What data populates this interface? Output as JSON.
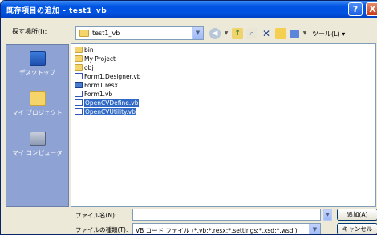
{
  "window": {
    "title": "既存項目の追加 - test1_vb",
    "help_label": "?",
    "close_label": "X"
  },
  "look_in": {
    "label": "探す場所(I):",
    "value": "test1_vb"
  },
  "toolbar": {
    "tools_label": "ツール(L)"
  },
  "places": [
    {
      "label": "デスクトップ",
      "icon": "desktop-icon"
    },
    {
      "label": "マイ プロジェクト",
      "icon": "my-projects-icon"
    },
    {
      "label": "マイ コンピュータ",
      "icon": "my-computer-icon"
    }
  ],
  "files": [
    {
      "name": "bin",
      "type": "folder",
      "selected": false
    },
    {
      "name": "My Project",
      "type": "folder",
      "selected": false
    },
    {
      "name": "obj",
      "type": "folder",
      "selected": false
    },
    {
      "name": "Form1.Designer.vb",
      "type": "vb",
      "selected": false
    },
    {
      "name": "Form1.resx",
      "type": "resx",
      "selected": false
    },
    {
      "name": "Form1.vb",
      "type": "vb",
      "selected": false
    },
    {
      "name": "OpenCVDefine.vb",
      "type": "vb",
      "selected": true
    },
    {
      "name": "OpenCVUtility.vb",
      "type": "vb",
      "selected": true
    }
  ],
  "file_name": {
    "label": "ファイル名(N):",
    "value": ""
  },
  "file_type": {
    "label": "ファイルの種類(T):",
    "value": "VB コード ファイル (*.vb;*.resx;*.settings;*.xsd;*.wsdl)"
  },
  "buttons": {
    "add": "追加(A)",
    "cancel": "キャンセル"
  },
  "colors": {
    "titlebar": "#0054e3",
    "selection": "#316ac5",
    "places_bar": "#8ea3d3",
    "dialog_bg": "#ece9d8"
  }
}
